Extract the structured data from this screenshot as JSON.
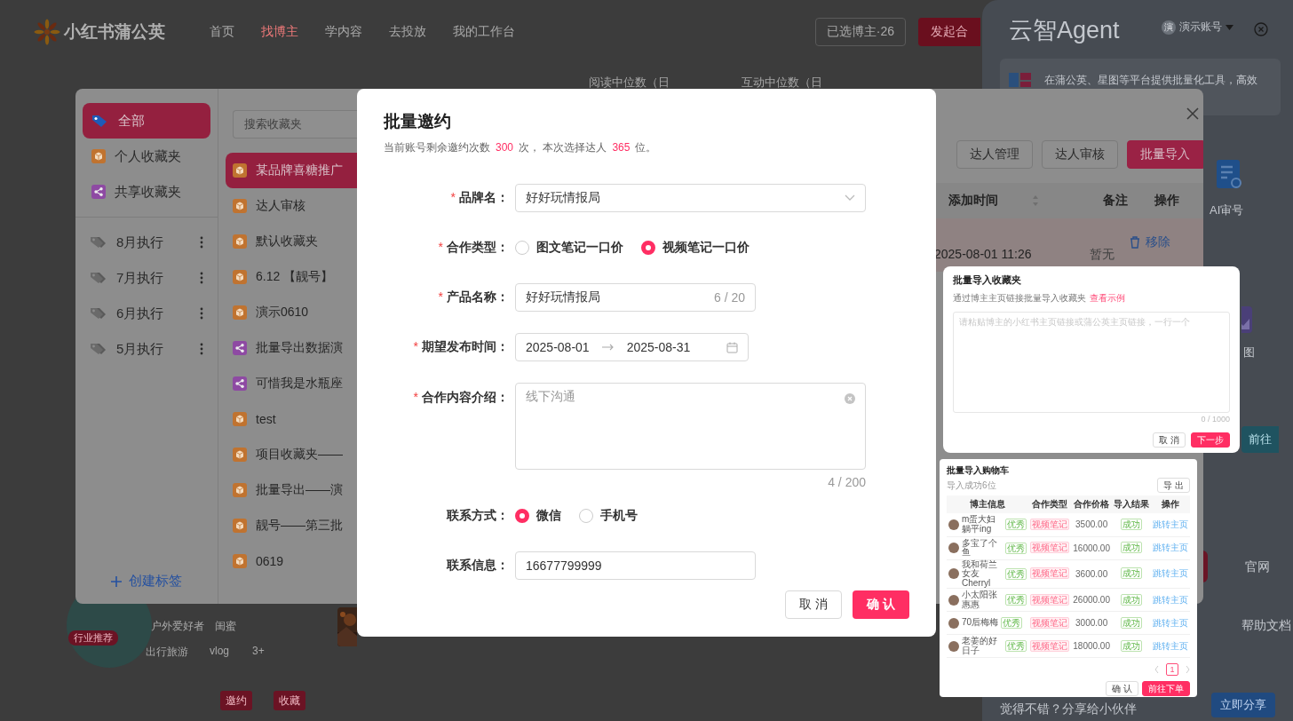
{
  "nav": {
    "logo": "小红书蒲公英",
    "items": [
      {
        "label": "首页",
        "selected": false
      },
      {
        "label": "找博主",
        "selected": true
      },
      {
        "label": "学内容",
        "selected": false
      },
      {
        "label": "去投放",
        "selected": false
      },
      {
        "label": "我的工作台",
        "selected": false
      }
    ],
    "selected_count": "已选博主·26",
    "start_button": "发起合"
  },
  "background": {
    "column_headers": [
      "阅读中位数（日",
      "互动中位数（日"
    ],
    "creator": {
      "badge": "行业推荐",
      "tags": [
        "户外爱好者",
        "闺蜜"
      ],
      "topics": [
        "出行旅游",
        "vlog",
        "3+"
      ]
    },
    "actions": [
      "邀约",
      "收藏"
    ]
  },
  "agent_panel": {
    "title": "云智Agent",
    "account_avatar": "演",
    "account": "演示账号",
    "intro": "在蒲公英、星图等平台提供批量化工具，高效",
    "tools": [
      "AI审号",
      "图"
    ],
    "go_button": "前往",
    "links": [
      "官网",
      "帮助文档"
    ],
    "share_text": "觉得不错？分享给小伙伴",
    "share_button": "立即分享"
  },
  "favorites_dialog": {
    "groups": [
      {
        "label": "全部",
        "kind": "all",
        "selected": true
      },
      {
        "label": "个人收藏夹",
        "kind": "personal",
        "selected": false
      },
      {
        "label": "共享收藏夹",
        "kind": "shared",
        "selected": false
      }
    ],
    "tags": [
      "8月执行",
      "7月执行",
      "6月执行",
      "5月执行"
    ],
    "create_tag": "创建标签",
    "search": {
      "placeholder": "搜索收藏夹"
    },
    "folders": [
      {
        "label": "某品牌喜糖推广",
        "kind": "personal",
        "selected": true
      },
      {
        "label": "达人审核",
        "kind": "personal",
        "selected": false
      },
      {
        "label": "默认收藏夹",
        "kind": "personal",
        "selected": false
      },
      {
        "label": "6.12 【靓号】",
        "kind": "personal",
        "selected": false
      },
      {
        "label": "演示0610",
        "kind": "personal",
        "selected": false
      },
      {
        "label": "批量导出数据演",
        "kind": "shared",
        "selected": false
      },
      {
        "label": "可惜我是水瓶座",
        "kind": "shared",
        "selected": false
      },
      {
        "label": "test",
        "kind": "personal",
        "selected": false
      },
      {
        "label": "项目收藏夹——",
        "kind": "personal",
        "selected": false
      },
      {
        "label": "批量导出——演",
        "kind": "personal",
        "selected": false
      },
      {
        "label": "靓号——第三批",
        "kind": "personal",
        "selected": false
      },
      {
        "label": "0619",
        "kind": "personal",
        "selected": false
      }
    ],
    "buttons": [
      {
        "label": "达人管理",
        "primary": false
      },
      {
        "label": "达人审核",
        "primary": false
      },
      {
        "label": "批量导入",
        "primary": true
      }
    ],
    "columns": [
      "添加时间",
      "备注",
      "操作"
    ],
    "row": {
      "added": "2025-08-01 11:26",
      "note": "暂无",
      "action": "移除"
    }
  },
  "invite_dialog": {
    "title": "批量邀约",
    "summary": {
      "before": "当前账号剩余邀约次数",
      "remaining": "300",
      "middle": "次， 本次选择达人",
      "count": "365",
      "after": "位。"
    },
    "fields": [
      {
        "kind": "select",
        "label": "品牌名：",
        "required_mark": "*",
        "value": "好好玩情报局"
      },
      {
        "kind": "radio",
        "label": "合作类型：",
        "required_mark": "*",
        "options": [
          {
            "label": "图文笔记一口价",
            "selected": false
          },
          {
            "label": "视频笔记一口价",
            "selected": true
          }
        ]
      },
      {
        "kind": "text",
        "label": "产品名称：",
        "required_mark": "*",
        "value": "好好玩情报局",
        "counter": "6 / 20"
      },
      {
        "kind": "daterange",
        "label": "期望发布时间：",
        "required_mark": "*",
        "start": "2025-08-01",
        "end": "2025-08-31"
      },
      {
        "kind": "textarea",
        "label": "合作内容介绍：",
        "required_mark": "*",
        "value": "线下沟通",
        "counter": "4 / 200"
      },
      {
        "kind": "radio",
        "label": "联系方式：",
        "options": [
          {
            "label": "微信",
            "selected": true
          },
          {
            "label": "手机号",
            "selected": false
          }
        ]
      },
      {
        "kind": "text",
        "label": "联系信息：",
        "value": "16677799999"
      }
    ],
    "cancel": "取 消",
    "confirm": "确 认"
  },
  "import_preview": {
    "title": "批量导入收藏夹",
    "description": "通过博主主页链接批量导入收藏夹",
    "link": "查看示例",
    "placeholder": "请粘贴博主的小红书主页链接或蒲公英主页链接，一行一个",
    "counter": "0 / 1000",
    "cancel": "取 消",
    "next": "下一步"
  },
  "cart_preview": {
    "title": "批量导入购物车",
    "subtitle": "导入成功6位",
    "export": "导 出",
    "columns": [
      "博主信息",
      "合作类型",
      "合作价格",
      "导入结果",
      "操作"
    ],
    "rows": [
      {
        "name": "m蛋大妇躺平ing",
        "tag": "优秀",
        "type": "视频笔记",
        "price": "3500.00",
        "result": "成功",
        "action": "跳转主页"
      },
      {
        "name": "多宝了个鱼",
        "tag": "优秀",
        "type": "视频笔记",
        "price": "16000.00",
        "result": "成功",
        "action": "跳转主页"
      },
      {
        "name": "我和荷兰女友Cherryl",
        "tag": "优秀",
        "type": "视频笔记",
        "price": "3600.00",
        "result": "成功",
        "action": "跳转主页"
      },
      {
        "name": "小太阳张惠惠",
        "tag": "优秀",
        "type": "视频笔记",
        "price": "26000.00",
        "result": "成功",
        "action": "跳转主页"
      },
      {
        "name": "70后梅梅",
        "tag": "优秀",
        "type": "视频笔记",
        "price": "3000.00",
        "result": "成功",
        "action": "跳转主页"
      },
      {
        "name": "老姜的好日子",
        "tag": "优秀",
        "type": "视频笔记",
        "price": "18000.00",
        "result": "成功",
        "action": "跳转主页"
      }
    ],
    "pages": [
      {
        "label": "1",
        "selected": true
      }
    ],
    "confirm": "确 认",
    "order": "前往下单"
  }
}
